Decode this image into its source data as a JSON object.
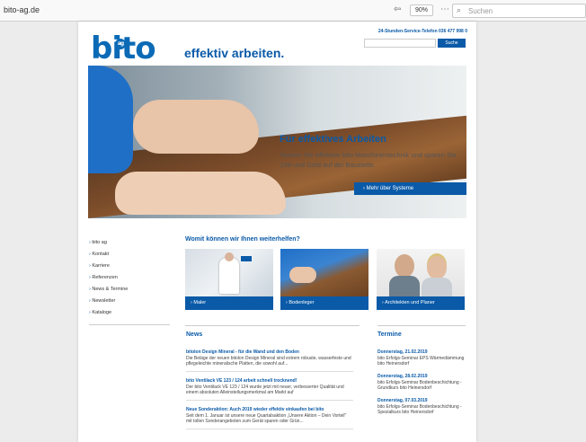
{
  "browser": {
    "url": "bito-ag.de",
    "zoom": "90%",
    "search_placeholder": "Suchen"
  },
  "header": {
    "logo_text": "bito",
    "logo_badge": "ag",
    "tagline": "effektiv arbeiten.",
    "hotline": "24-Stunden-Service-Telefon 036 477 998 0",
    "search_button": "Suche"
  },
  "hero": {
    "title": "Für effektives Arbeiten",
    "text": "Nutzen Sie effektive bito-Maschinentechnik und sparen Sie Zeit und Geld auf der Baustelle.",
    "button": "Mehr über Systeme"
  },
  "sidebar": {
    "items": [
      {
        "label": "bito ag"
      },
      {
        "label": "Kontakt"
      },
      {
        "label": "Karriere"
      },
      {
        "label": "Referenzen"
      },
      {
        "label": "News & Termine"
      },
      {
        "label": "Newsletter"
      },
      {
        "label": "Kataloge"
      }
    ]
  },
  "teaser": {
    "heading": "Womit können wir Ihnen weiterhelfen?",
    "tiles": [
      {
        "label": "Maler"
      },
      {
        "label": "Bodenleger"
      },
      {
        "label": "Architekten und Planer"
      }
    ]
  },
  "news": {
    "heading": "News",
    "items": [
      {
        "title": "bitolon Design Mineral - für die Wand und den Boden",
        "text": "Die Beläge der neuen bitolon Design Mineral sind extrem robuste, wasserfeste und pflegeleichte mineralische Platten, die sowohl auf..."
      },
      {
        "title": "bito Ventilack VE 123 / 124 arbeit schnell trocknend!",
        "text": "Der bito Ventilack VE 123 / 124 wurde jetzt mit neuer, verbesserter Qualität und einem absoluten Alleinstellungsmerkmal am Markt auf"
      },
      {
        "title": "Neue Sonderaktion: Auch 2019 wieder effektiv einkaufen bei bito",
        "text": "Seit dem 1. Januar ist unsere neue Quartalsaktion „Unsere Aktion – Dein Vorteil\" mit tollen Sonderangeboten zum Gerät sparen oder Grün..."
      }
    ]
  },
  "termine": {
    "heading": "Termine",
    "items": [
      {
        "date": "Donnerstag, 21.02.2019",
        "text": "bito Erfolgs-Seminar EPS Wärmedämmung bito Heinersdorf"
      },
      {
        "date": "Donnerstag, 28.02.2019",
        "text": "bito Erfolgs-Seminar Bodenbeschichtung - Grundkurs bito Heinersdorf"
      },
      {
        "date": "Donnerstag, 07.03.2019",
        "text": "bito Erfolgs-Seminar Bodenbeschichtung - Spezialkurs bito Heinersdorf"
      }
    ]
  },
  "colors": {
    "brand_blue": "#0a5aa8",
    "logo_blue": "#0a6ab6"
  }
}
